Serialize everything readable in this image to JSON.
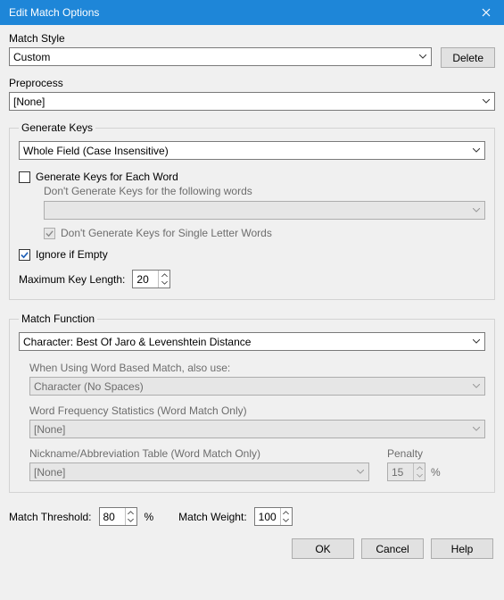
{
  "title": "Edit Match Options",
  "match_style": {
    "label": "Match Style",
    "value": "Custom"
  },
  "delete_btn": "Delete",
  "preprocess": {
    "label": "Preprocess",
    "value": "[None]"
  },
  "generate_keys": {
    "legend": "Generate Keys",
    "combo": "Whole Field (Case Insensitive)",
    "each_word": {
      "label": "Generate Keys for Each Word",
      "checked": false,
      "sublabel": "Don't Generate Keys for the following words",
      "words_value": "",
      "single_letter": {
        "label": "Don't Generate Keys for Single Letter Words",
        "checked": true
      }
    },
    "ignore_empty": {
      "label": "Ignore if Empty",
      "checked": true
    },
    "max_key_len": {
      "label": "Maximum Key Length:",
      "value": "20"
    }
  },
  "match_function": {
    "legend": "Match Function",
    "combo": "Character: Best Of Jaro & Levenshtein Distance",
    "word_based": {
      "label": "When Using Word Based Match, also use:",
      "value": "Character (No Spaces)"
    },
    "word_freq": {
      "label": "Word Frequency Statistics (Word Match Only)",
      "value": "[None]"
    },
    "nickname": {
      "label": "Nickname/Abbreviation Table (Word Match Only)",
      "value": "[None]"
    },
    "penalty": {
      "label": "Penalty",
      "value": "15",
      "suffix": "%"
    }
  },
  "match_threshold": {
    "label": "Match Threshold:",
    "value": "80",
    "suffix": "%"
  },
  "match_weight": {
    "label": "Match Weight:",
    "value": "100"
  },
  "buttons": {
    "ok": "OK",
    "cancel": "Cancel",
    "help": "Help"
  }
}
